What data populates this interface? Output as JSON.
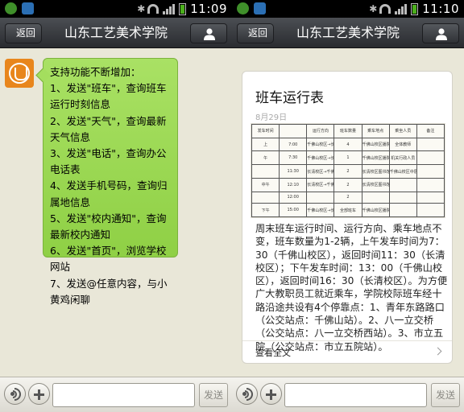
{
  "left": {
    "status": {
      "time": "11:09"
    },
    "header": {
      "back_label": "返回",
      "title": "山东工艺美术学院"
    },
    "message": {
      "lines": [
        "支持功能不断增加：",
        "1、发送\"班车\"，查询班车",
        "运行时刻信息",
        "2、发送\"天气\"，查询最新",
        "天气信息",
        "3、发送\"电话\"，查询办公",
        "电话表",
        "4、发送手机号码，查询归",
        "属地信息",
        "5、发送\"校内通知\"，查询",
        "最新校内通知",
        "6、发送\"首页\"，浏览学校",
        "网站",
        "7、发送@任意内容，与小",
        "黄鸡闲聊"
      ]
    },
    "input": {
      "send_label": "发送",
      "value": ""
    }
  },
  "right": {
    "status": {
      "time": "11:10"
    },
    "header": {
      "back_label": "返回",
      "title": "山东工艺美术学院"
    },
    "card": {
      "title": "班车运行表",
      "date": "8月29日",
      "body": "周末班车运行时间、运行方向、乘车地点不变，班车数量为1-2辆，上午发车时间为7：30（千佛山校区），返回时间11：30（长清校区）；下午发车时间：13：00（千佛山校区），返回时间16：30（长清校区）。为方便广大教职员工就近乘车，学院校际班车经十路沿途共设有4个停靠点：1、青年东路路口（公交站点：千佛山站）。2、八一立交桥（公交站点：八一立交桥西站）。3、市立五院（公交站点：市立五院站）。",
      "read_more": "查看全文",
      "thumbnail_table": {
        "headers": [
          "发车时间",
          "",
          "运行方向",
          "班车数量",
          "乘车地点",
          "乘坐人员",
          "备注"
        ],
        "rows": [
          [
            "上",
            "7:00",
            "千佛山校区→长清校区",
            "4",
            "千佛山校区播院",
            "全体教师",
            ""
          ],
          [
            "午",
            "7:30",
            "千佛山校区→长清校区",
            "1",
            "千佛山校区播院",
            "机关行政人员",
            ""
          ],
          [
            "",
            "11:30",
            "长清校区→千佛山校区",
            "2",
            "长清校区图书馆北侧",
            "千佛山校区中层以上干部及部分机关行政人员",
            ""
          ],
          [
            "中午",
            "12:10",
            "长清校区→千佛山校区",
            "2",
            "长清校区图书馆北侧",
            "",
            ""
          ],
          [
            "",
            "12:00",
            "",
            "2",
            "",
            "",
            ""
          ],
          [
            "下午",
            "15:00",
            "千佛山校区→长清校区",
            "全部班车",
            "千佛山校区播院",
            "",
            ""
          ]
        ]
      }
    },
    "input": {
      "send_label": "发送",
      "value": ""
    }
  },
  "icons": {
    "back": "back-arrow-icon",
    "profile": "person-icon",
    "voice": "voice-icon",
    "plus": "plus-icon",
    "chevron": "chevron-right-icon"
  },
  "colors": {
    "bubble_green": "#9ad851",
    "title_bar": "#3a3c40",
    "chat_bg": "#e9e7d8"
  }
}
